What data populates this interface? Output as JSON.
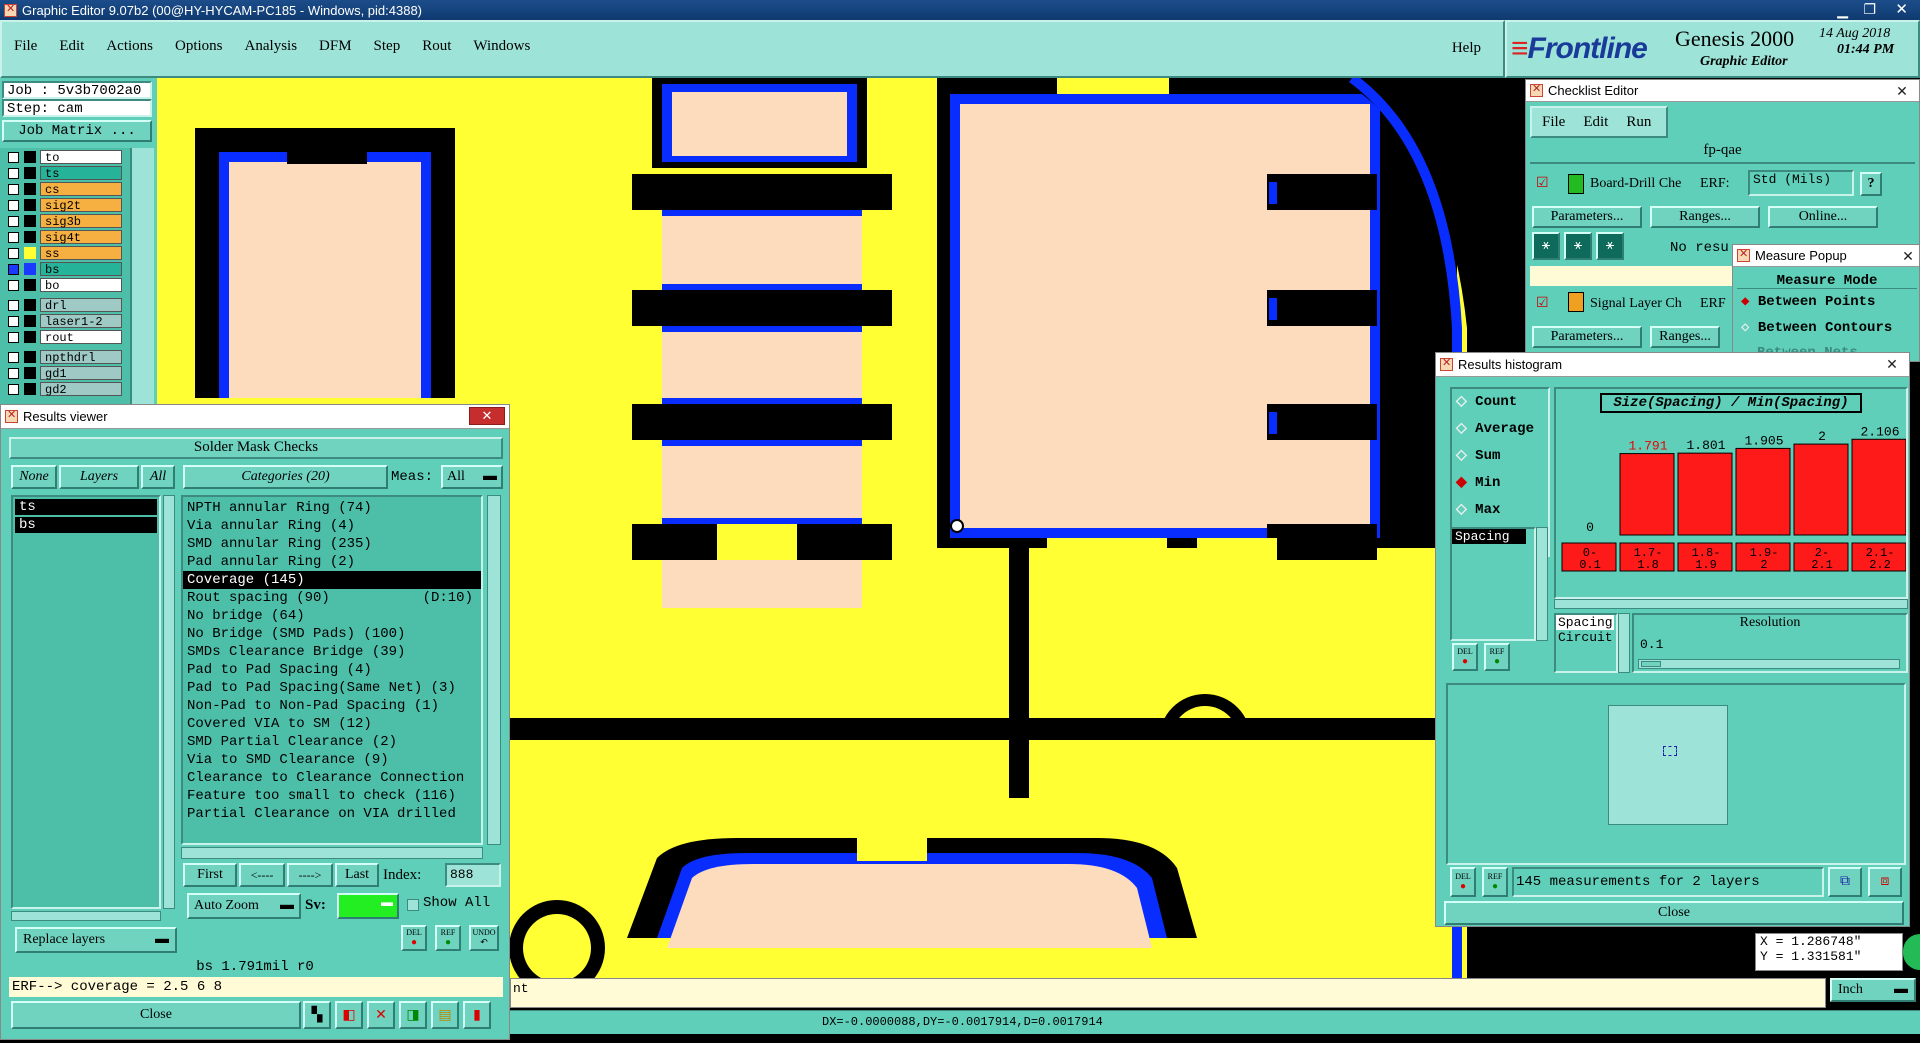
{
  "titlebar": {
    "title": "Graphic Editor 9.07b2 (00@HY-HYCAM-PC185 - Windows, pid:4388)"
  },
  "menu": {
    "items": [
      "File",
      "Edit",
      "Actions",
      "Options",
      "Analysis",
      "DFM",
      "Step",
      "Rout",
      "Windows"
    ],
    "help": "Help"
  },
  "brand": {
    "logo": "Frontline",
    "product": "Genesis 2000",
    "subtitle": "Graphic Editor",
    "date": "14 Aug 2018",
    "time": "01:44 PM"
  },
  "job": {
    "job_label": "Job : 5v3b7002a0",
    "step_label": "Step: cam",
    "matrix_button": "Job Matrix ..."
  },
  "layers": [
    {
      "name": "to",
      "color": "#ffffff"
    },
    {
      "name": "ts",
      "color": "#25b39a"
    },
    {
      "name": "cs",
      "color": "#f5b041"
    },
    {
      "name": "sig2t",
      "color": "#f5b041"
    },
    {
      "name": "sig3b",
      "color": "#f5b041"
    },
    {
      "name": "sig4t",
      "color": "#f5b041"
    },
    {
      "name": "ss",
      "color": "#f5b041"
    },
    {
      "name": "bs",
      "color": "#25b39a"
    },
    {
      "name": "bo",
      "color": "#ffffff"
    },
    {
      "name": "drl",
      "color": "#9ec9c4"
    },
    {
      "name": "laser1-2",
      "color": "#9ec9c4"
    },
    {
      "name": "rout",
      "color": "#ffffff"
    },
    {
      "name": "npthdrl",
      "color": "#9ec9c4"
    },
    {
      "name": "gd1",
      "color": "#9ec9c4"
    },
    {
      "name": "gd2",
      "color": "#9ec9c4"
    }
  ],
  "results_viewer": {
    "title": "Results viewer",
    "heading": "Solder Mask Checks",
    "none_btn": "None",
    "layers_btn": "Layers",
    "all_btn": "All",
    "categories_label": "Categories (20)",
    "meas_label": "Meas:",
    "meas_value": "All",
    "layer_list": [
      "ts",
      "bs"
    ],
    "categories": [
      "NPTH annular Ring (74)",
      "Via annular Ring (4)",
      "SMD annular Ring (235)",
      "Pad annular Ring (2)",
      "Coverage (145)",
      "Rout spacing (90)",
      "No bridge (64)",
      "No Bridge (SMD Pads) (100)",
      "SMDs Clearance Bridge (39)",
      "Pad to Pad Spacing (4)",
      "Pad to Pad Spacing(Same Net) (3)",
      "Non-Pad to Non-Pad Spacing (1)",
      "Covered VIA to SM (12)",
      "SMD Partial Clearance (2)",
      "Via to SMD Clearance (9)",
      "Clearance to Clearance Connection",
      "Feature too small to check (116)",
      "Partial Clearance on VIA drilled"
    ],
    "rout_spacing_extra": "(D:10)",
    "first": "First",
    "prev": "<----",
    "next": "---->",
    "last": "Last",
    "index_label": "Index:",
    "index_value": "888",
    "replace_layers": "Replace layers",
    "auto_zoom": "Auto Zoom",
    "sv_label": "Sv:",
    "show_all": "Show All",
    "del": "DEL",
    "ref": "REF",
    "undo": "UNDO",
    "status": "bs 1.791mil  r0",
    "erf_line": "ERF--> coverage = 2.5 6 8",
    "close": "Close"
  },
  "checklist_editor": {
    "title": "Checklist Editor",
    "menu": [
      "File",
      "Edit",
      "Run"
    ],
    "checklist_name": "fp-qae",
    "row1_name": "Board-Drill Che",
    "erf_label": "ERF:",
    "erf_value": "Std (Mils)",
    "help": "?",
    "parameters": "Parameters...",
    "ranges": "Ranges...",
    "online": "Online...",
    "no_results": "No resu",
    "row2_name": "Signal Layer Ch",
    "row2_erf": "ERF"
  },
  "measure_popup": {
    "title": "Measure Popup",
    "mode_heading": "Measure Mode",
    "opt1": "Between Points",
    "opt2": "Between Contours",
    "opt3": "Between Nets"
  },
  "histogram": {
    "title": "Results histogram",
    "stats": [
      "Count",
      "Average",
      "Sum",
      "Min",
      "Max"
    ],
    "selected_stat": "Min",
    "field_item": "Spacing",
    "chart_title": "Size(Spacing) / Min(Spacing)",
    "resolution_label": "Resolution",
    "resolution_value": "0.1",
    "spacing_circuit_1": "Spacing",
    "spacing_circuit_2": "Circuit",
    "footer": "145 measurements for 2 layers",
    "close": "Close",
    "del": "DEL",
    "ref": "REF"
  },
  "chart_data": {
    "type": "bar",
    "title": "Size(Spacing) / Min(Spacing)",
    "categories": [
      "0-0.1",
      "1.7-1.8",
      "1.8-1.9",
      "1.9-2",
      "2-2.1",
      "2.1-2.2"
    ],
    "category_lines": [
      [
        "0-",
        "0.1"
      ],
      [
        "1.7-",
        "1.8"
      ],
      [
        "1.8-",
        "1.9"
      ],
      [
        "1.9-",
        "2"
      ],
      [
        "2-",
        "2.1"
      ],
      [
        "2.1-",
        "2.2"
      ]
    ],
    "values": [
      0,
      1.791,
      1.801,
      1.905,
      2,
      2.106
    ],
    "labels": [
      "0",
      "1.791",
      "1.801",
      "1.905",
      "2",
      "2.106"
    ],
    "ylim": [
      0,
      2.2
    ],
    "bar_color": "#ff1a1a",
    "highlight_index": 1
  },
  "coords": {
    "x": "X = 1.286748\"",
    "y": "Y = 1.331581\""
  },
  "units": "Inch",
  "bottom_status": "DX=-0.0000088,DY=-0.0017914,D=0.0017914",
  "prompt_partial": "nt",
  "colors": {
    "panel": "#5fcfb9",
    "board": "#ffff33",
    "pad": "#fddcbe",
    "trace": "#000000",
    "mask": "#0a2dff",
    "accent": "#9de3d8"
  }
}
